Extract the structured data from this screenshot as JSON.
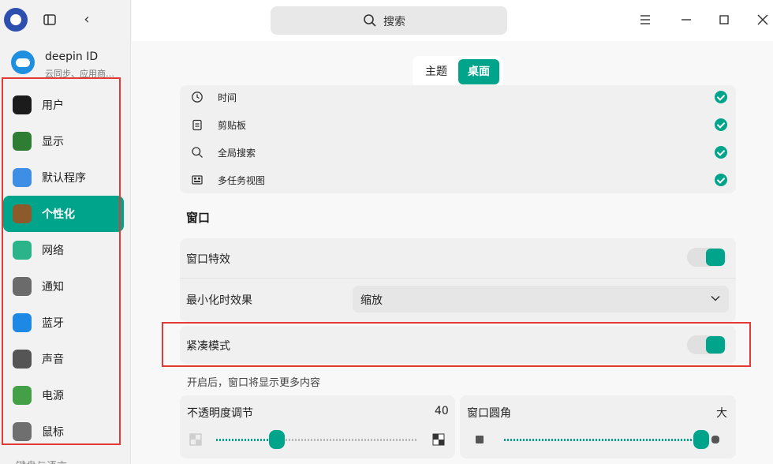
{
  "sidebar": {
    "account": {
      "title": "deepin ID",
      "subtitle": "云同步、应用商…"
    },
    "items": [
      {
        "label": "用户",
        "icon": "user-icon",
        "color": "#1b1b1b"
      },
      {
        "label": "显示",
        "icon": "display-icon",
        "color": "#2e7d32"
      },
      {
        "label": "默认程序",
        "icon": "default-apps-icon",
        "color": "#3f8ee6"
      },
      {
        "label": "个性化",
        "icon": "personalization-icon",
        "color": "#8d5a2b",
        "active": true
      },
      {
        "label": "网络",
        "icon": "network-icon",
        "color": "#2bb38a"
      },
      {
        "label": "通知",
        "icon": "bell-icon",
        "color": "#6b6b6b"
      },
      {
        "label": "蓝牙",
        "icon": "bluetooth-icon",
        "color": "#1e88e5"
      },
      {
        "label": "声音",
        "icon": "speaker-icon",
        "color": "#555555"
      },
      {
        "label": "电源",
        "icon": "battery-icon",
        "color": "#43a047"
      },
      {
        "label": "鼠标",
        "icon": "mouse-icon",
        "color": "#6f6f6f"
      }
    ],
    "partial_item": "键盘与语言"
  },
  "titlebar": {
    "search_label": "搜索"
  },
  "tabs": [
    {
      "label": "主题"
    },
    {
      "label": "桌面",
      "active": true
    }
  ],
  "plugin_list": [
    {
      "label": "时间",
      "icon": "clock-icon"
    },
    {
      "label": "剪贴板",
      "icon": "clipboard-icon"
    },
    {
      "label": "全局搜索",
      "icon": "search-icon"
    },
    {
      "label": "多任务视图",
      "icon": "multitask-view-icon"
    }
  ],
  "window_section": {
    "title": "窗口",
    "effects_label": "窗口特效",
    "effects_on": true,
    "minimize_label": "最小化时效果",
    "minimize_value": "缩放",
    "compact_label": "紧凑模式",
    "compact_on": true,
    "compact_hint": "开启后，窗口将显示更多内容",
    "opacity": {
      "label": "不透明度调节",
      "value": "40",
      "level": 0.3
    },
    "radius": {
      "label": "窗口圆角",
      "value": "大",
      "level": 1.0
    }
  },
  "colors": {
    "accent": "#00a48a",
    "highlight_box": "#e53935"
  }
}
